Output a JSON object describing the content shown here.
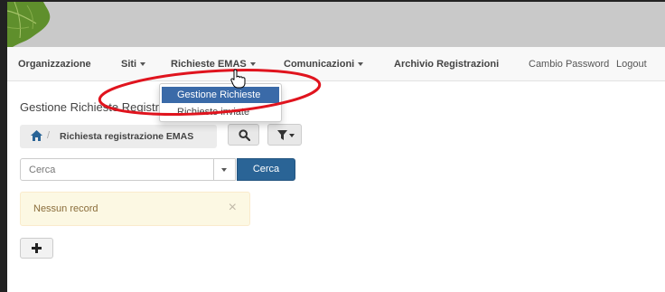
{
  "navbar": {
    "items": [
      {
        "label": "Organizzazione",
        "bold": true
      },
      {
        "label": "Siti",
        "bold": true,
        "dropdown": true
      },
      {
        "label": "Richieste EMAS",
        "bold": true,
        "dropdown": true
      },
      {
        "label": "Comunicazioni",
        "bold": true,
        "dropdown": true
      },
      {
        "label": "Archivio Registrazioni",
        "bold": true
      },
      {
        "label": "Cambio Password",
        "bold": false
      },
      {
        "label": "Logout",
        "bold": false
      }
    ]
  },
  "dropdown_menu": {
    "items": [
      {
        "label": "Gestione Richieste",
        "active": true
      },
      {
        "label": "Richieste inviate",
        "active": false
      }
    ]
  },
  "page": {
    "title": "Gestione Richieste Registrazione"
  },
  "breadcrumb": {
    "home_icon": "home-icon",
    "label": "Richiesta registrazione EMAS"
  },
  "toolbar": {
    "search_icon": "search-icon",
    "filter_icon": "filter-icon"
  },
  "search": {
    "placeholder": "Cerca",
    "button_label": "Cerca"
  },
  "alert": {
    "message": "Nessun record",
    "close_glyph": "×"
  },
  "add_button": {
    "icon": "plus-icon"
  },
  "colors": {
    "header_bg": "#c9c9c9",
    "navbar_bg": "#f8f8f8",
    "primary": "#2a6496",
    "dropdown_active": "#3a6aa8",
    "alert_bg": "#fcf8e3",
    "annotation_red": "#e0141e"
  }
}
